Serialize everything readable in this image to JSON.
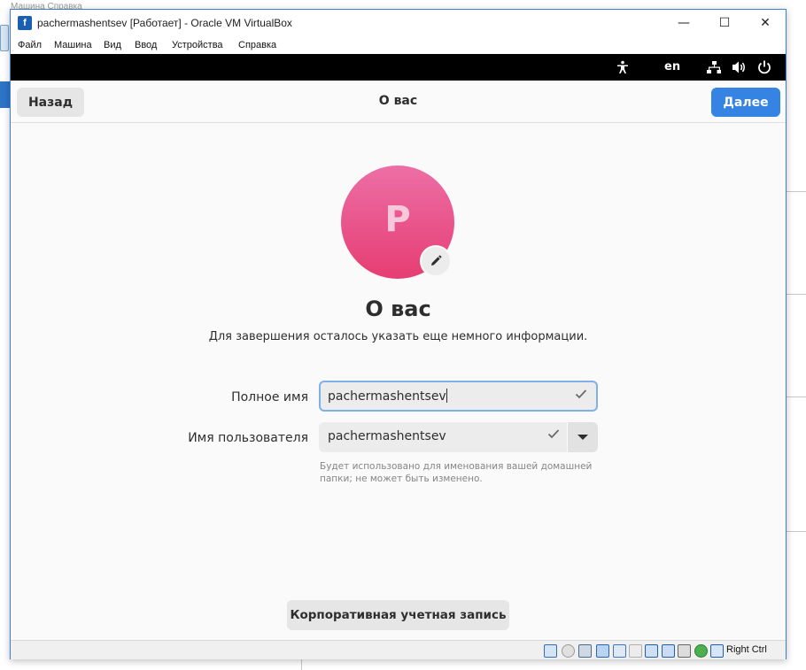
{
  "background": {
    "menu_text": "Машина    Справка"
  },
  "window": {
    "title": "pachermashentsev [Работает] - Oracle VM VirtualBox",
    "app_icon_letter": "f",
    "controls": {
      "minimize": "—",
      "maximize": "☐",
      "close": "✕"
    }
  },
  "menubar": {
    "items": [
      "Файл",
      "Машина",
      "Вид",
      "Ввод",
      "Устройства",
      "Справка"
    ]
  },
  "gnome_topbar": {
    "accessibility_icon": "accessibility-icon",
    "language": "en",
    "network_icon": "network-icon",
    "volume_icon": "volume-icon",
    "power_icon": "power-icon"
  },
  "header": {
    "back_label": "Назад",
    "title": "О вас",
    "next_label": "Далее"
  },
  "avatar": {
    "letter": "P",
    "edit_icon": "pencil-icon"
  },
  "page": {
    "heading": "О вас",
    "subtitle": "Для завершения осталось указать еще немного информации."
  },
  "form": {
    "fullname_label": "Полное имя",
    "fullname_value": "pachermashentsev",
    "username_label": "Имя пользователя",
    "username_value": "pachermashentsev",
    "username_hint": "Будет использовано для именования вашей домашней папки; не может быть изменено."
  },
  "enterprise_button_label": "Корпоративная учетная запись",
  "statusbar": {
    "host_key_label": "Right Ctrl"
  },
  "colors": {
    "accent": "#3584e4",
    "avatar_top": "#ec6fa5",
    "avatar_bottom": "#e63d73",
    "window_border": "#3b7fd4"
  }
}
